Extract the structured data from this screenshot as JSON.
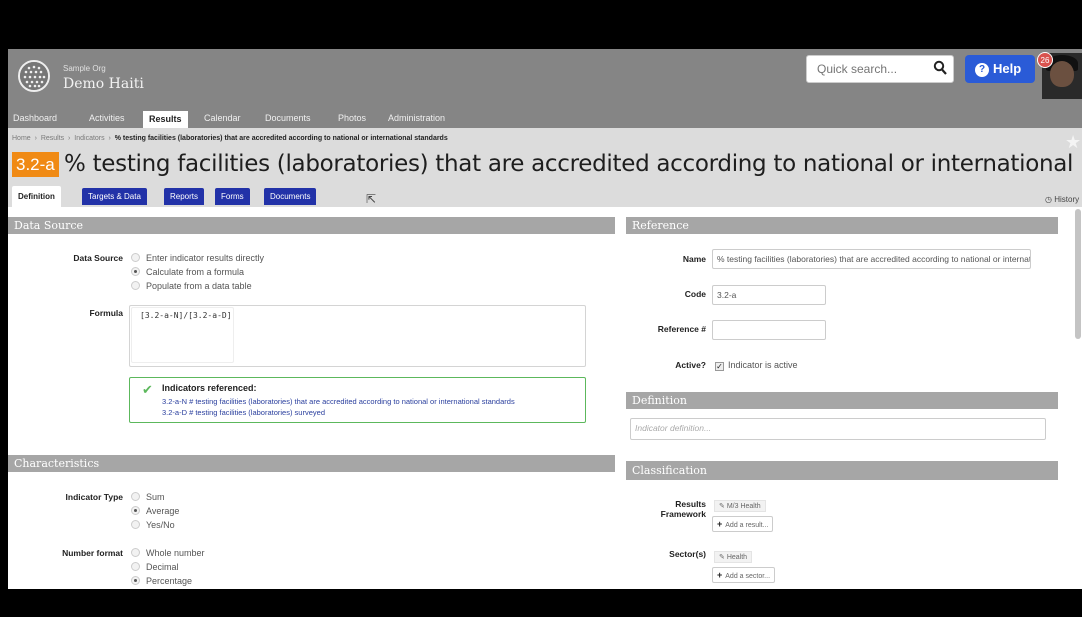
{
  "org": {
    "small": "Sample Org",
    "name": "Demo Haiti"
  },
  "search": {
    "placeholder": "Quick search..."
  },
  "help_label": "Help",
  "notifications_count": "26",
  "nav": [
    "Dashboard",
    "Activities",
    "Results",
    "Calendar",
    "Documents",
    "Photos",
    "Administration"
  ],
  "nav_active": "Results",
  "breadcrumb": {
    "home": "Home",
    "results": "Results",
    "indicators": "Indicators",
    "current": "% testing facilities (laboratories) that are accredited according to national or international standards"
  },
  "indicator_code": "3.2-a",
  "title": "% testing facilities (laboratories) that are accredited according to national or international sta...",
  "tabs": [
    "Definition",
    "Targets & Data",
    "Reports",
    "Forms",
    "Documents"
  ],
  "history_label": "History",
  "data_source": {
    "section": "Data Source",
    "label": "Data Source",
    "options": [
      "Enter indicator results directly",
      "Calculate from a formula",
      "Populate from a data table"
    ],
    "selected": "Calculate from a formula",
    "formula_label": "Formula",
    "formula": "[3.2-a-N]/[3.2-a-D]",
    "referenced_title": "Indicators referenced:",
    "referenced": [
      "3.2-a-N # testing facilities (laboratories) that are accredited according to national or international standards",
      "3.2-a-D # testing facilities (laboratories) surveyed"
    ]
  },
  "characteristics": {
    "section": "Characteristics",
    "type_label": "Indicator Type",
    "type_options": [
      "Sum",
      "Average",
      "Yes/No"
    ],
    "type_selected": "Average",
    "format_label": "Number format",
    "format_options": [
      "Whole number",
      "Decimal",
      "Percentage"
    ],
    "format_selected": "Percentage"
  },
  "reference": {
    "section": "Reference",
    "name_label": "Name",
    "name_value": "% testing facilities (laboratories) that are accredited according to national or international standards",
    "code_label": "Code",
    "code_value": "3.2-a",
    "refnum_label": "Reference #",
    "refnum_value": "",
    "active_label": "Active?",
    "active_text": "Indicator is active"
  },
  "definition": {
    "section": "Definition",
    "placeholder": "Indicator definition..."
  },
  "classification": {
    "section": "Classification",
    "results_label_1": "Results",
    "results_label_2": "Framework",
    "results_tag": "M/3 Health",
    "results_add": "Add a result...",
    "sectors_label": "Sector(s)",
    "sectors_tag": "Health",
    "sectors_add": "Add a sector..."
  }
}
